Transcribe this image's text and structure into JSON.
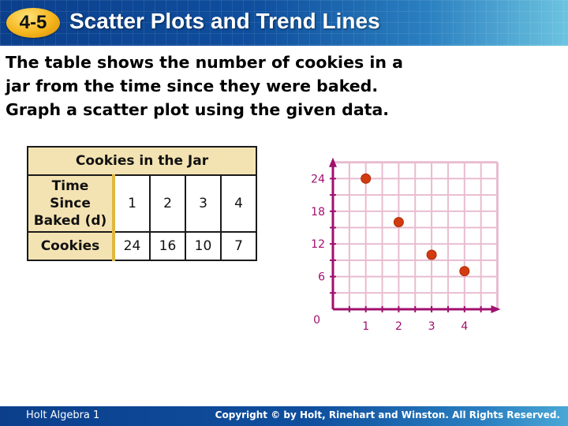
{
  "header": {
    "lesson_number": "4-5",
    "title": "Scatter Plots and Trend Lines"
  },
  "prompt": {
    "lines": [
      "The table shows the number of cookies in a",
      "jar from the time since they were baked.",
      "Graph a scatter plot using the given data."
    ]
  },
  "table": {
    "caption": "Cookies in the Jar",
    "row_headers": [
      "Time Since Baked (d)",
      "Cookies"
    ],
    "row_header_lines": [
      [
        "Time Since",
        "Baked (d)"
      ],
      [
        "Cookies"
      ]
    ],
    "time": [
      "1",
      "2",
      "3",
      "4"
    ],
    "cookies": [
      "24",
      "16",
      "10",
      "7"
    ]
  },
  "chart_data": {
    "type": "scatter",
    "title": "",
    "xlabel": "",
    "ylabel": "",
    "x": [
      1,
      2,
      3,
      4
    ],
    "y": [
      24,
      16,
      10,
      7
    ],
    "xlim": [
      0,
      5
    ],
    "ylim": [
      0,
      27
    ],
    "x_ticks": [
      1,
      2,
      3,
      4
    ],
    "y_ticks": [
      6,
      12,
      18,
      24
    ],
    "origin_label": "0",
    "grid": true,
    "colors": {
      "axis": "#a0106e",
      "grid": "#e8bcd0",
      "point": "#d23a10"
    }
  },
  "footer": {
    "left": "Holt Algebra 1",
    "right": "Copyright © by Holt, Rinehart and Winston. All Rights Reserved."
  }
}
